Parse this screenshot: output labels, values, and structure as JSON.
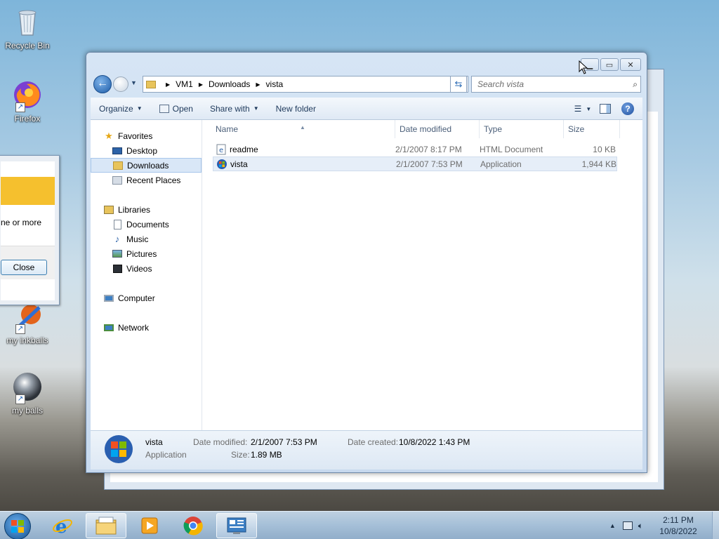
{
  "desktop": {
    "icons": [
      {
        "label": "Recycle Bin",
        "icon": "recycle-bin-icon"
      },
      {
        "label": "Firefox",
        "icon": "firefox-icon"
      },
      {
        "label": "my inkballs",
        "icon": "inkball-icon"
      },
      {
        "label": "my balls",
        "icon": "ball-icon"
      }
    ]
  },
  "back_dialog": {
    "message_fragment": "ne or more",
    "close_label": "Close"
  },
  "explorer": {
    "breadcrumb": [
      "VM1",
      "Downloads",
      "vista"
    ],
    "search_placeholder": "Search vista",
    "toolbar": {
      "organize": "Organize",
      "open": "Open",
      "share_with": "Share with",
      "new_folder": "New folder"
    },
    "nav": {
      "favorites": "Favorites",
      "desktop": "Desktop",
      "downloads": "Downloads",
      "recent_places": "Recent Places",
      "libraries": "Libraries",
      "documents": "Documents",
      "music": "Music",
      "pictures": "Pictures",
      "videos": "Videos",
      "computer": "Computer",
      "network": "Network"
    },
    "columns": {
      "name": "Name",
      "date_modified": "Date modified",
      "type": "Type",
      "size": "Size"
    },
    "files": [
      {
        "name": "readme",
        "date": "2/1/2007 8:17 PM",
        "type": "HTML Document",
        "size": "10 KB"
      },
      {
        "name": "vista",
        "date": "2/1/2007 7:53 PM",
        "type": "Application",
        "size": "1,944 KB"
      }
    ],
    "details": {
      "name": "vista",
      "type": "Application",
      "date_modified_label": "Date modified:",
      "date_modified": "2/1/2007 7:53 PM",
      "size_label": "Size:",
      "size": "1.89 MB",
      "date_created_label": "Date created:",
      "date_created": "10/8/2022 1:43 PM"
    }
  },
  "taskbar": {
    "time": "2:11 PM",
    "date": "10/8/2022"
  },
  "colors": {
    "accent": "#1d5ca8",
    "selection": "#d9e7f7"
  }
}
